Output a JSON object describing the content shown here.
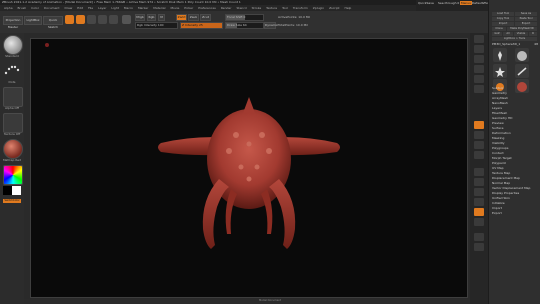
{
  "window": {
    "title": "ZBrush 2021.1.2 Academy of Animation - [Model Document] • Free Mem 1.766GB • Active Mem 974 • Scratch Disk Mem 1 Poly Count 10.0 Mil • Mesh Count 1"
  },
  "menu": [
    "Alpha",
    "Brush",
    "Color",
    "Document",
    "Draw",
    "Edit",
    "File",
    "Layer",
    "Light",
    "Macro",
    "Marker",
    "Material",
    "Movie",
    "Picker",
    "Preferences",
    "Render",
    "Stencil",
    "Stroke",
    "Texture",
    "Tool",
    "Transform",
    "Zplugin",
    "Zscript",
    "Help"
  ],
  "top_right": {
    "quicksave": "QuickSave",
    "see_through": "See-through 0",
    "menus": "Menus",
    "default_zscript": "DefaultZScript"
  },
  "toolbar": {
    "projection_master": "Projection Master",
    "lightbox": "LightBox",
    "quick_sketch": "Quick Sketch",
    "edit": "Edit",
    "draw": "Draw",
    "move": "Move",
    "scale": "Scale",
    "rotate": "Rotate",
    "mrgb": "Mrgb",
    "rgb": "Rgb",
    "m": "M",
    "zadd": "Zadd",
    "zsub": "Zsub",
    "zcut": "Zcut",
    "focal_shift": "Focal Shift 0",
    "draw_size": "Draw Size 64",
    "dynamic": "Dynamic",
    "z_intensity": "Z Intensity 25",
    "rgb_intensity": "Rgb Intensity 100",
    "active_points": "ActivePoints: 10.0 Mil",
    "total_points": "TotalPoints: 10.0 Mil"
  },
  "left_panel": {
    "brush_label": "Standard",
    "stroke_label": "Dots",
    "alpha_label": "Alpha Off",
    "texture_label": "Texture Off",
    "material_label": "MatCap Red",
    "gradient_label": "Gradient",
    "switch_color": "SwitchColor",
    "alternate": "Alternate"
  },
  "right_panel": {
    "tool_menu": [
      "Load Tool",
      "Save As",
      "Copy Tool",
      "Paste Tool",
      "Import",
      "Export",
      "Clone",
      "Make PolyMesh3D",
      "GoZ",
      "All",
      "Visible",
      "R",
      "Lightbox > Tools"
    ],
    "current_tool": "PM3D_Sphere3D_1",
    "current_tool_value": "48",
    "subpalettes": [
      "Subtool",
      "Geometry",
      "ArrayMesh",
      "NanoMesh",
      "Layers",
      "FiberMesh",
      "Geometry HD",
      "Preview",
      "Surface",
      "Deformation",
      "Masking",
      "Visibility",
      "Polygroups",
      "Contact",
      "Morph Target",
      "Polypaint",
      "UV Map",
      "Texture Map",
      "Displacement Map",
      "Normal Map",
      "Vector Displacement Map",
      "Display Properties",
      "Unified Skin",
      "Initialize",
      "Import",
      "Export"
    ]
  },
  "colors": {
    "accent": "#e07a1f",
    "model": "#b0463a",
    "canvas": "#0a0a0a"
  },
  "status": {
    "viewport_footer": "Model Document"
  }
}
